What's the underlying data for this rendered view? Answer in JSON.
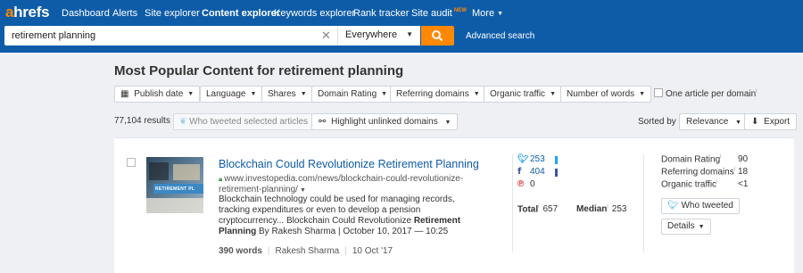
{
  "nav": {
    "logo_a": "a",
    "logo_rest": "hrefs",
    "items": [
      "Dashboard",
      "Alerts",
      "Site explorer",
      "Content explorer",
      "Keywords explorer",
      "Rank tracker",
      "Site audit",
      "More"
    ],
    "new_badge": "NEW"
  },
  "search": {
    "query": "retirement planning",
    "location": "Everywhere",
    "advanced": "Advanced search"
  },
  "page": {
    "title": "Most Popular Content for retirement planning"
  },
  "filters": [
    "Publish date",
    "Language",
    "Shares",
    "Domain Rating",
    "Referring domains",
    "Organic traffic",
    "Number of words"
  ],
  "one_article": "One article per domain",
  "toolbar": {
    "results": "77,104 results",
    "who_tweeted_selected": "Who tweeted selected articles",
    "highlight": "Highlight unlinked domains",
    "sorted_by": "Sorted by",
    "sort_value": "Relevance",
    "export": "Export"
  },
  "result": {
    "thumb_banner": "RETIREMENT PL",
    "title": "Blockchain Could Revolutionize Retirement Planning",
    "url": "www.investopedia.com/news/blockchain-could-revolutionize-retirement-planning/",
    "desc_1": "Blockchain technology could be used for managing records, tracking expenditures or even to develop a pension cryptocurrency... Blockchain Could Revolutionize ",
    "desc_bold_1": "Retirement",
    "desc_bold_2": "Planning",
    "desc_2": " By Rakesh Sharma | October 10, 2017 — 10:25",
    "words": "390 words",
    "author": "Rakesh Sharma",
    "date": "10 Oct '17",
    "social": {
      "twitter": "253",
      "facebook": "404",
      "pinterest": "0",
      "total_label": "Total",
      "total": "657",
      "median_label": "Median",
      "median": "253"
    },
    "metrics": {
      "dr_label": "Domain Rating",
      "dr": "90",
      "rd_label": "Referring domains",
      "rd": "18",
      "ot_label": "Organic traffic",
      "ot": "<1"
    },
    "who_tweeted": "Who tweeted",
    "details": "Details"
  },
  "colors": {
    "brand_blue": "#0e5ca8",
    "accent_orange": "#ff8800",
    "twitter": "#1da1f2",
    "facebook": "#3b5998",
    "pinterest": "#cb2027"
  }
}
